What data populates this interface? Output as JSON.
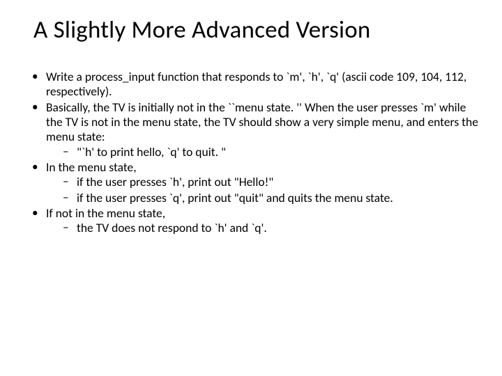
{
  "title": "A Slightly More Advanced Version",
  "bullets": {
    "b1": "Write a process_input function that responds to `m', `h', `q' (ascii code 109, 104, 112, respectively).",
    "b2": "Basically, the TV is initially not in the ``menu state. '' When the user presses `m' while the TV is not in the menu state, the TV should show a very simple menu, and enters the menu state:",
    "b2_s1": "\"`h' to print hello, `q' to quit. \"",
    "b3": "In the menu state,",
    "b3_s1": "if the user presses `h', print out \"Hello!\"",
    "b3_s2": "if the user presses `q', print out  \"quit\" and quits the menu state.",
    "b4": "If not in the menu state,",
    "b4_s1": "the TV does not respond to `h' and `q'."
  }
}
